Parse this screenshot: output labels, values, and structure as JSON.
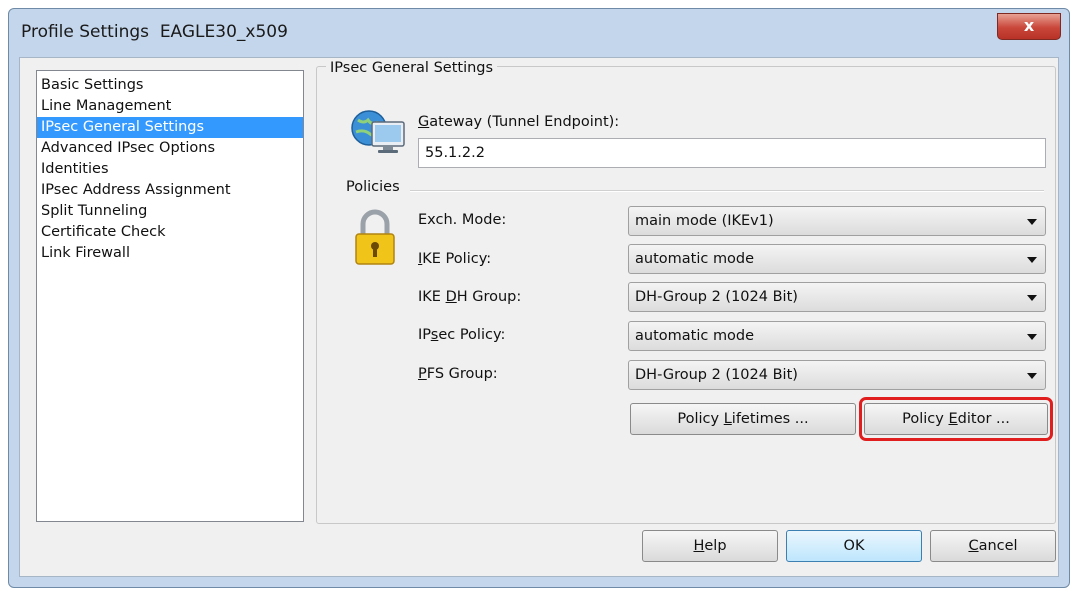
{
  "window": {
    "title": "Profile Settings",
    "profile_name": "EAGLE30_x509",
    "close_glyph": "x"
  },
  "nav": {
    "items": [
      {
        "label": "Basic Settings",
        "selected": false
      },
      {
        "label": "Line Management",
        "selected": false
      },
      {
        "label": "IPsec General Settings",
        "selected": true
      },
      {
        "label": "Advanced IPsec Options",
        "selected": false
      },
      {
        "label": "Identities",
        "selected": false
      },
      {
        "label": "IPsec Address Assignment",
        "selected": false
      },
      {
        "label": "Split Tunneling",
        "selected": false
      },
      {
        "label": "Certificate Check",
        "selected": false
      },
      {
        "label": "Link Firewall",
        "selected": false
      }
    ]
  },
  "panel": {
    "group_title": "IPsec General Settings",
    "gateway": {
      "label_access": "G",
      "label_rest": "ateway (Tunnel Endpoint):",
      "value": "55.1.2.2"
    },
    "policies": {
      "title": "Policies",
      "exch_mode": {
        "label": "Exch. Mode:",
        "value": "main mode (IKEv1)"
      },
      "ike_policy": {
        "label_access": "I",
        "label_rest": "KE Policy:",
        "value": "automatic mode"
      },
      "ike_dh_group": {
        "label_pre": "IKE ",
        "label_access": "D",
        "label_rest": "H Group:",
        "value": "DH-Group 2 (1024 Bit)"
      },
      "ipsec_policy": {
        "label_pre": "IP",
        "label_access": "s",
        "label_rest": "ec Policy:",
        "value": "automatic mode"
      },
      "pfs_group": {
        "label_access": "P",
        "label_rest": "FS Group:",
        "value": "DH-Group 2 (1024 Bit)"
      }
    },
    "buttons": {
      "policy_lifetimes": {
        "pre": "Policy ",
        "access": "L",
        "rest": "ifetimes ..."
      },
      "policy_editor": {
        "pre": "Policy ",
        "access": "E",
        "rest": "ditor ..."
      }
    }
  },
  "footer": {
    "help": {
      "access": "H",
      "rest": "elp"
    },
    "ok": {
      "label": "OK"
    },
    "cancel": {
      "access": "C",
      "rest": "ancel"
    }
  },
  "icons": {
    "gateway": "globe-monitor-icon",
    "policies": "padlock-icon"
  },
  "colors": {
    "selection": "#3399ff",
    "highlight": "#e01e1e",
    "close": "#c9463a"
  }
}
